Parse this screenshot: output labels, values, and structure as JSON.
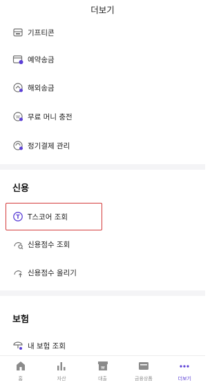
{
  "header": {
    "title": "더보기"
  },
  "menu_top": [
    {
      "label": "기프티콘",
      "icon": "gift-card-icon"
    },
    {
      "label": "예약송금",
      "icon": "calendar-transfer-icon"
    },
    {
      "label": "해외송금",
      "icon": "foreign-remittance-icon"
    },
    {
      "label": "무료 머니 충전",
      "icon": "money-charge-icon"
    },
    {
      "label": "정기결제 관리",
      "icon": "recurring-payment-icon"
    }
  ],
  "sections": {
    "credit": {
      "title": "신용",
      "items": [
        {
          "label": "T스코어 조회",
          "icon": "t-score-icon"
        },
        {
          "label": "신용점수 조회",
          "icon": "credit-score-icon"
        },
        {
          "label": "신용점수 올리기",
          "icon": "credit-boost-icon"
        }
      ]
    },
    "insurance": {
      "title": "보험",
      "items": [
        {
          "label": "내 보험 조회",
          "icon": "insurance-search-icon"
        }
      ]
    }
  },
  "tabbar": [
    {
      "label": "홈",
      "icon": "home-icon",
      "active": false
    },
    {
      "label": "자산",
      "icon": "asset-chart-icon",
      "active": false
    },
    {
      "label": "대출",
      "icon": "loan-icon",
      "active": false
    },
    {
      "label": "금융상품",
      "icon": "financial-product-icon",
      "active": false
    },
    {
      "label": "더보기",
      "icon": "more-dots-icon",
      "active": true
    }
  ],
  "colors": {
    "accent": "#5b3fd6",
    "highlight_border": "#d33a3a",
    "icon_gray": "#6e6e6e"
  }
}
